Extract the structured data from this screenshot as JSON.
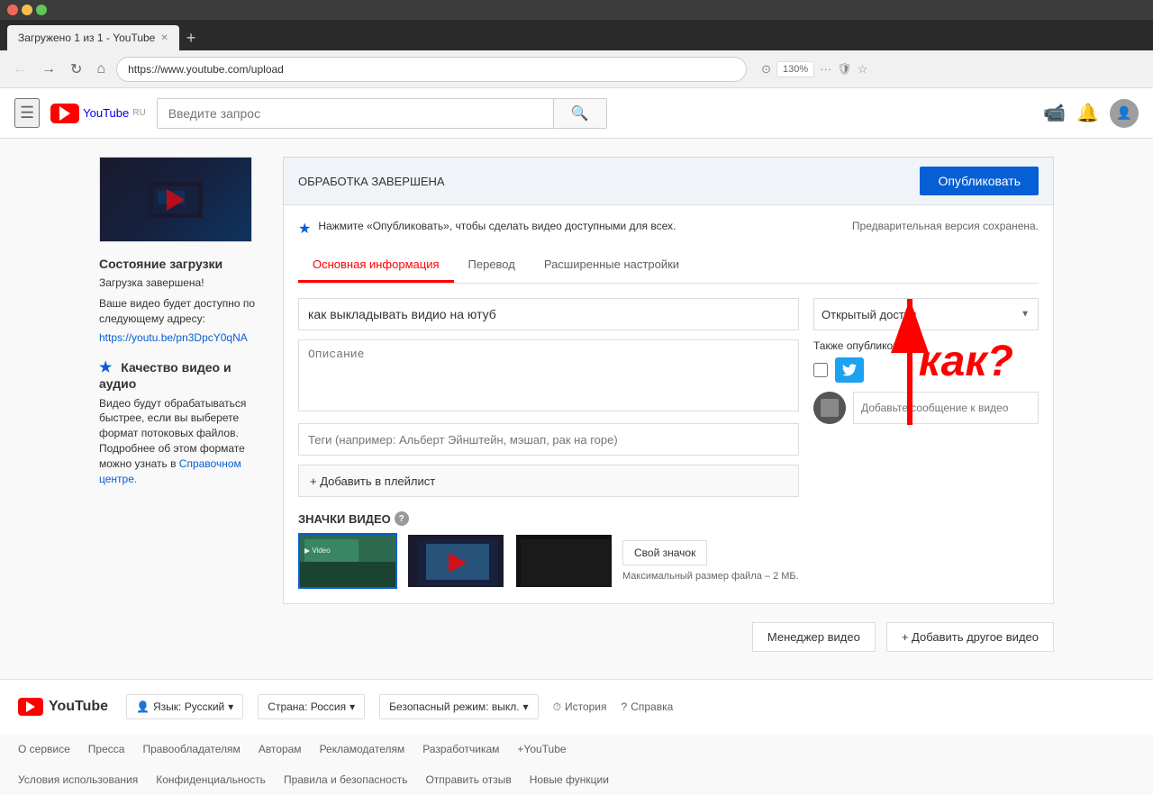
{
  "browser": {
    "tab_title": "Загружено 1 из 1 - YouTube",
    "address": "https://www.youtube.com/upload",
    "zoom": "130%",
    "dots": [
      "#ed6a5a",
      "#f5bf4f",
      "#62c554"
    ]
  },
  "header": {
    "search_placeholder": "Введите запрос",
    "logo_text": "YouTube",
    "logo_ru": "RU"
  },
  "form": {
    "status_label": "ОБРАБОТКА ЗАВЕРШЕНА",
    "publish_btn": "Опубликовать",
    "info_text": "Нажмите «Опубликовать», чтобы сделать видео доступными для всех.",
    "preview_saved": "Предварительная версия сохранена.",
    "tabs": [
      "Основная информация",
      "Перевод",
      "Расширенные настройки"
    ],
    "active_tab": 0,
    "title_value": "как выкладывать видио на ютуб",
    "title_placeholder": "",
    "desc_placeholder": "Описание",
    "tags_placeholder": "Теги (например: Альберт Эйнштейн, мэшап, рак на горе)",
    "playlist_btn": "+ Добавить в плейлист",
    "access_label": "Открытый доступ",
    "also_publish": "Также опубликовать в",
    "social_placeholder": "Добавьте сообщение к видео",
    "thumbnails_label": "ЗНАЧКИ ВИДЕО",
    "custom_thumb_btn": "Свой значок",
    "max_size_text": "Максимальный размер файла – 2 МБ."
  },
  "upload_status": {
    "title": "Состояние загрузки",
    "done": "Загрузка завершена!",
    "desc": "Ваше видео будет доступно по следующему адресу:",
    "link": "https://youtu.be/pn3DpcY0qNA",
    "quality_title": "Качество видео и аудио",
    "quality_desc": "Видео будут обрабатываться быстрее, если вы выберете формат потоковых файлов. Подробнее об этом формате можно узнать в",
    "quality_link": "Справочном центре."
  },
  "bottom_actions": {
    "manager_btn": "Менеджер видео",
    "add_btn": "+ Добавить другое видео"
  },
  "footer": {
    "logo_text": "YouTube",
    "lang_btn": "Язык: Русский",
    "country_btn": "Страна: Россия",
    "safety_btn": "Безопасный режим: выкл.",
    "history_link": "История",
    "help_link": "Справка",
    "links": [
      "О сервисе",
      "Пресса",
      "Правообладателям",
      "Авторам",
      "Рекламодателям",
      "Разработчикам",
      "+YouTube"
    ],
    "legal_links": [
      "Условия использования",
      "Конфиденциальность",
      "Правила и безопасность",
      "Отправить отзыв",
      "Новые функции"
    ]
  },
  "kak_text": "как?"
}
